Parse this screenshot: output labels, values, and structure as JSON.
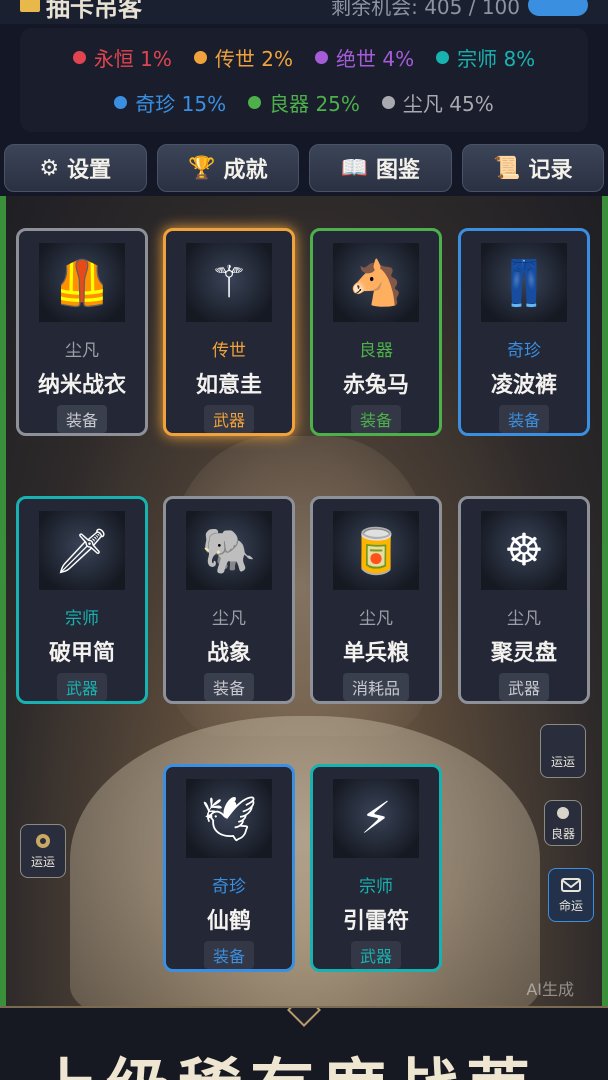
{
  "header": {
    "title": "抽卡吊客",
    "chance_text": "剩余机会: 405 / 100"
  },
  "probabilities": {
    "row1": [
      {
        "label": "永恒 1%",
        "color": "#e0454f"
      },
      {
        "label": "传世 2%",
        "color": "#f0a23c"
      },
      {
        "label": "绝世 4%",
        "color": "#a65cd8"
      },
      {
        "label": "宗师 8%",
        "color": "#18b3b0"
      }
    ],
    "row2": [
      {
        "label": "奇珍 15%",
        "color": "#3a8fe0"
      },
      {
        "label": "良器 25%",
        "color": "#4db04b"
      },
      {
        "label": "尘凡 45%",
        "color": "#a8aab0"
      }
    ]
  },
  "nav": [
    {
      "label": "设置",
      "icon": "gear-icon",
      "glyph": "⚙"
    },
    {
      "label": "成就",
      "icon": "trophy-icon",
      "glyph": "🏆"
    },
    {
      "label": "图鉴",
      "icon": "book-icon",
      "glyph": "📖"
    },
    {
      "label": "记录",
      "icon": "scroll-icon",
      "glyph": "📜"
    }
  ],
  "cards": [
    {
      "rarity": "尘凡",
      "name": "纳米战衣",
      "type": "装备",
      "tier": "common",
      "icon": "armor-icon",
      "glyph": "🦺"
    },
    {
      "rarity": "传世",
      "name": "如意圭",
      "type": "武器",
      "tier": "legend",
      "icon": "scepter-icon",
      "glyph": "⚚"
    },
    {
      "rarity": "良器",
      "name": "赤兔马",
      "type": "装备",
      "tier": "good",
      "icon": "horse-icon",
      "glyph": "🐴"
    },
    {
      "rarity": "奇珍",
      "name": "凌波裤",
      "type": "装备",
      "tier": "rare",
      "icon": "pants-icon",
      "glyph": "👖"
    },
    {
      "rarity": "宗师",
      "name": "破甲简",
      "type": "武器",
      "tier": "master",
      "icon": "blade-icon",
      "glyph": "🗡"
    },
    {
      "rarity": "尘凡",
      "name": "战象",
      "type": "装备",
      "tier": "common",
      "icon": "elephant-icon",
      "glyph": "🐘"
    },
    {
      "rarity": "尘凡",
      "name": "单兵粮",
      "type": "消耗品",
      "tier": "common",
      "icon": "ration-icon",
      "glyph": "🥫"
    },
    {
      "rarity": "尘凡",
      "name": "聚灵盘",
      "type": "武器",
      "tier": "common",
      "icon": "disc-icon",
      "glyph": "☸"
    },
    {
      "rarity": "奇珍",
      "name": "仙鹤",
      "type": "装备",
      "tier": "rare",
      "icon": "crane-icon",
      "glyph": "🕊"
    },
    {
      "rarity": "宗师",
      "name": "引雷符",
      "type": "武器",
      "tier": "master",
      "icon": "talisman-icon",
      "glyph": "⚡"
    }
  ],
  "tier_colors": {
    "common": "#9ea0a8",
    "legend": "#f0a23c",
    "good": "#4db04b",
    "rare": "#3a8fe0",
    "master": "#18b3b0"
  },
  "side_buttons": {
    "left_luck": "运运",
    "right_luck": "运运",
    "right_good": "良器",
    "right_fate": "命运"
  },
  "ai_mark": "AI生成",
  "bottom_text": "上级稀有度战莱"
}
